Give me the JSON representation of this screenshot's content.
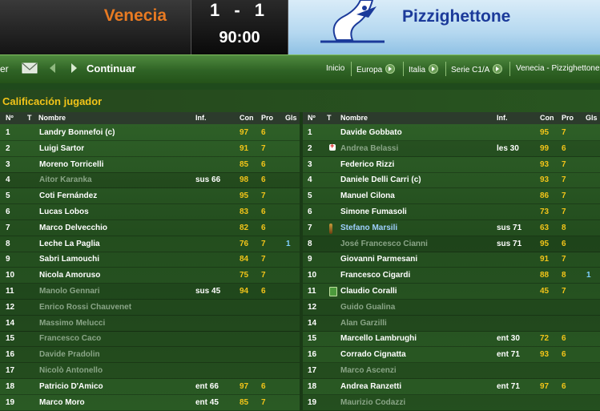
{
  "match": {
    "home_team": "Venecia",
    "away_team": "Pizzighettone",
    "score_home": "1",
    "score_sep": "-",
    "score_away": "1",
    "time": "90:00"
  },
  "nav": {
    "left_label": "er",
    "continue_label": "Continuar",
    "breadcrumbs": [
      "Inicio",
      "Europa",
      "Italia",
      "Serie C1/A",
      "Venecia - Pizzighettone"
    ]
  },
  "section_title": "Calificación jugador",
  "columns": {
    "num": "Nº",
    "t": "T",
    "name": "Nombre",
    "inf": "Inf.",
    "con": "Con",
    "pro": "Pro",
    "gls": "Gls"
  },
  "home_players": [
    {
      "num": "1",
      "name": "Landry Bonnefoi (c)",
      "inf": "",
      "con": "97",
      "pro": "6",
      "gls": "",
      "dim": false
    },
    {
      "num": "2",
      "name": "Luigi Sartor",
      "inf": "",
      "con": "91",
      "pro": "7",
      "gls": "",
      "dim": false
    },
    {
      "num": "3",
      "name": "Moreno Torricelli",
      "inf": "",
      "con": "85",
      "pro": "6",
      "gls": "",
      "dim": false
    },
    {
      "num": "4",
      "name": "Aitor Karanka",
      "inf": "sus 66",
      "con": "98",
      "pro": "6",
      "gls": "",
      "dim": true
    },
    {
      "num": "5",
      "name": "Coti Fernández",
      "inf": "",
      "con": "95",
      "pro": "7",
      "gls": "",
      "dim": false
    },
    {
      "num": "6",
      "name": "Lucas Lobos",
      "inf": "",
      "con": "83",
      "pro": "6",
      "gls": "",
      "dim": false
    },
    {
      "num": "7",
      "name": "Marco Delvecchio",
      "inf": "",
      "con": "82",
      "pro": "6",
      "gls": "",
      "dim": false
    },
    {
      "num": "8",
      "name": "Leche La Paglia",
      "inf": "",
      "con": "76",
      "pro": "7",
      "gls": "1",
      "dim": false
    },
    {
      "num": "9",
      "name": "Sabri Lamouchi",
      "inf": "",
      "con": "84",
      "pro": "7",
      "gls": "",
      "dim": false
    },
    {
      "num": "10",
      "name": "Nicola Amoruso",
      "inf": "",
      "con": "75",
      "pro": "7",
      "gls": "",
      "dim": false
    },
    {
      "num": "11",
      "name": "Manolo Gennari",
      "inf": "sus 45",
      "con": "94",
      "pro": "6",
      "gls": "",
      "dim": true
    },
    {
      "num": "12",
      "name": "Enrico Rossi Chauvenet",
      "inf": "",
      "con": "",
      "pro": "",
      "gls": "",
      "dim": true
    },
    {
      "num": "14",
      "name": "Massimo Melucci",
      "inf": "",
      "con": "",
      "pro": "",
      "gls": "",
      "dim": true
    },
    {
      "num": "15",
      "name": "Francesco Caco",
      "inf": "",
      "con": "",
      "pro": "",
      "gls": "",
      "dim": true
    },
    {
      "num": "16",
      "name": "Davide Pradolin",
      "inf": "",
      "con": "",
      "pro": "",
      "gls": "",
      "dim": true
    },
    {
      "num": "17",
      "name": "Nicolò Antonello",
      "inf": "",
      "con": "",
      "pro": "",
      "gls": "",
      "dim": true
    },
    {
      "num": "18",
      "name": "Patricio D'Amico",
      "inf": "ent 66",
      "con": "97",
      "pro": "6",
      "gls": "",
      "dim": false
    },
    {
      "num": "19",
      "name": "Marco Moro",
      "inf": "ent 45",
      "con": "85",
      "pro": "7",
      "gls": "",
      "dim": false
    }
  ],
  "away_players": [
    {
      "num": "1",
      "name": "Davide Gobbato",
      "inf": "",
      "con": "95",
      "pro": "7",
      "gls": "",
      "dim": false,
      "icon": ""
    },
    {
      "num": "2",
      "name": "Andrea Belassi",
      "inf": "les 30",
      "con": "99",
      "pro": "6",
      "gls": "",
      "dim": true,
      "icon": "injury"
    },
    {
      "num": "3",
      "name": "Federico Rizzi",
      "inf": "",
      "con": "93",
      "pro": "7",
      "gls": "",
      "dim": false,
      "icon": ""
    },
    {
      "num": "4",
      "name": "Daniele Delli Carri (c)",
      "inf": "",
      "con": "93",
      "pro": "7",
      "gls": "",
      "dim": false,
      "icon": ""
    },
    {
      "num": "5",
      "name": "Manuel Cilona",
      "inf": "",
      "con": "86",
      "pro": "7",
      "gls": "",
      "dim": false,
      "icon": ""
    },
    {
      "num": "6",
      "name": "Simone Fumasoli",
      "inf": "",
      "con": "73",
      "pro": "7",
      "gls": "",
      "dim": false,
      "icon": ""
    },
    {
      "num": "7",
      "name": "Stefano Marsili",
      "inf": "sus 71",
      "con": "63",
      "pro": "8",
      "gls": "",
      "dim": false,
      "icon": "bottle",
      "blue": true
    },
    {
      "num": "8",
      "name": "José Francesco Cianni",
      "inf": "sus 71",
      "con": "95",
      "pro": "6",
      "gls": "",
      "dim": true,
      "icon": ""
    },
    {
      "num": "9",
      "name": "Giovanni Parmesani",
      "inf": "",
      "con": "91",
      "pro": "7",
      "gls": "",
      "dim": false,
      "icon": ""
    },
    {
      "num": "10",
      "name": "Francesco Cigardi",
      "inf": "",
      "con": "88",
      "pro": "8",
      "gls": "1",
      "dim": false,
      "icon": ""
    },
    {
      "num": "11",
      "name": "Claudio Coralli",
      "inf": "",
      "con": "45",
      "pro": "7",
      "gls": "",
      "dim": false,
      "icon": "green"
    },
    {
      "num": "12",
      "name": "Guido Gualina",
      "inf": "",
      "con": "",
      "pro": "",
      "gls": "",
      "dim": true,
      "icon": ""
    },
    {
      "num": "14",
      "name": "Alan Garzilli",
      "inf": "",
      "con": "",
      "pro": "",
      "gls": "",
      "dim": true,
      "icon": ""
    },
    {
      "num": "15",
      "name": "Marcello Lambrughi",
      "inf": "ent 30",
      "con": "72",
      "pro": "6",
      "gls": "",
      "dim": false,
      "icon": ""
    },
    {
      "num": "16",
      "name": "Corrado Cignatta",
      "inf": "ent 71",
      "con": "93",
      "pro": "6",
      "gls": "",
      "dim": false,
      "icon": ""
    },
    {
      "num": "17",
      "name": "Marco Ascenzi",
      "inf": "",
      "con": "",
      "pro": "",
      "gls": "",
      "dim": true,
      "icon": ""
    },
    {
      "num": "18",
      "name": "Andrea Ranzetti",
      "inf": "ent 71",
      "con": "97",
      "pro": "6",
      "gls": "",
      "dim": false,
      "icon": ""
    },
    {
      "num": "19",
      "name": "Maurizio Codazzi",
      "inf": "",
      "con": "",
      "pro": "",
      "gls": "",
      "dim": true,
      "icon": ""
    }
  ],
  "colors": {
    "home": "#e87a22",
    "away": "#1b3a9a",
    "accent": "#f2c419"
  }
}
